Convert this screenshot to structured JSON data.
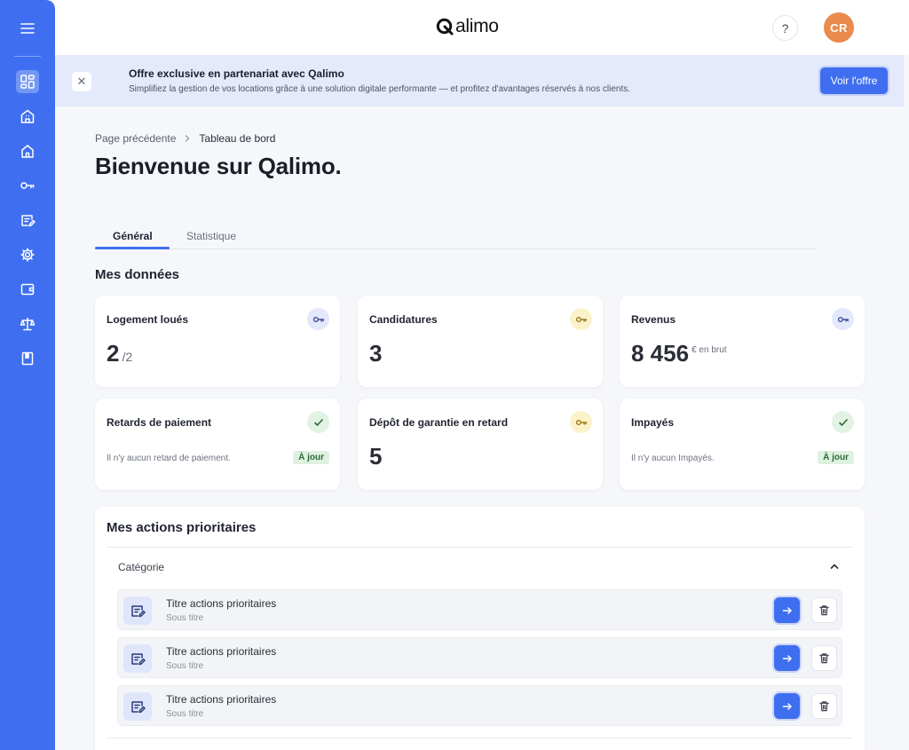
{
  "app": {
    "name": "Qalimo",
    "logo_text": "alimo",
    "accent": "#3f6ff0"
  },
  "sidebar": {
    "menu_icon": "menu-icon",
    "items": [
      {
        "name": "dashboard",
        "icon": "dashboard-icon",
        "active": true
      },
      {
        "name": "building",
        "icon": "building-icon",
        "active": false
      },
      {
        "name": "home",
        "icon": "home-icon",
        "active": false
      },
      {
        "name": "key",
        "icon": "key-icon",
        "active": false
      },
      {
        "name": "edit",
        "icon": "edit-document-icon",
        "active": false
      },
      {
        "name": "settings",
        "icon": "gear-icon",
        "active": false
      },
      {
        "name": "wallet",
        "icon": "wallet-icon",
        "active": false
      },
      {
        "name": "legal",
        "icon": "scale-icon",
        "active": false
      },
      {
        "name": "book",
        "icon": "book-icon",
        "active": false
      }
    ]
  },
  "header": {
    "help_label": "?",
    "avatar_initials": "CR",
    "avatar_color": "#ea8a4c"
  },
  "banner": {
    "close_label": "✕",
    "title": "Offre exclusive en partenariat avec Qalimo",
    "text": "Simplifiez la gestion de vos locations grâce à une solution digitale performante — et profitez d'avantages réservés à nos clients.",
    "button_label": "Voir l'offre"
  },
  "breadcrumb": {
    "previous": "Page précédente",
    "current": "Tableau de bord"
  },
  "page_title": "Bienvenue sur Qalimo.",
  "tabs": [
    {
      "label": "Général",
      "active": true
    },
    {
      "label": "Statistique",
      "active": false
    }
  ],
  "section_title": "Mes données",
  "cards": {
    "logements": {
      "title": "Logement loués",
      "value": "2",
      "suffix": "/2",
      "icon": "key-icon",
      "icon_color": "blue"
    },
    "candidatures": {
      "title": "Candidatures",
      "value": "3",
      "icon": "key-icon",
      "icon_color": "yellow"
    },
    "revenus": {
      "title": "Revenus",
      "value": "8 456",
      "unit": "€ en brut",
      "icon": "key-icon",
      "icon_color": "blue"
    },
    "retards": {
      "title": "Retards de paiement",
      "note": "Il n'y aucun retard de paiement.",
      "badge": "À jour",
      "icon": "check-icon",
      "icon_color": "green"
    },
    "depot": {
      "title": "Dépôt de garantie en retard",
      "value": "5",
      "icon": "key-icon",
      "icon_color": "yellow"
    },
    "impayes": {
      "title": "Impayés",
      "note": "Il n'y aucun Impayés.",
      "badge": "À jour",
      "icon": "check-icon",
      "icon_color": "green"
    }
  },
  "actions": {
    "title": "Mes actions prioritaires",
    "category": "Catégorie",
    "rows": [
      {
        "title": "Titre actions prioritaires",
        "subtitle": "Sous titre"
      },
      {
        "title": "Titre actions prioritaires",
        "subtitle": "Sous titre"
      },
      {
        "title": "Titre actions prioritaires",
        "subtitle": "Sous titre"
      }
    ]
  }
}
